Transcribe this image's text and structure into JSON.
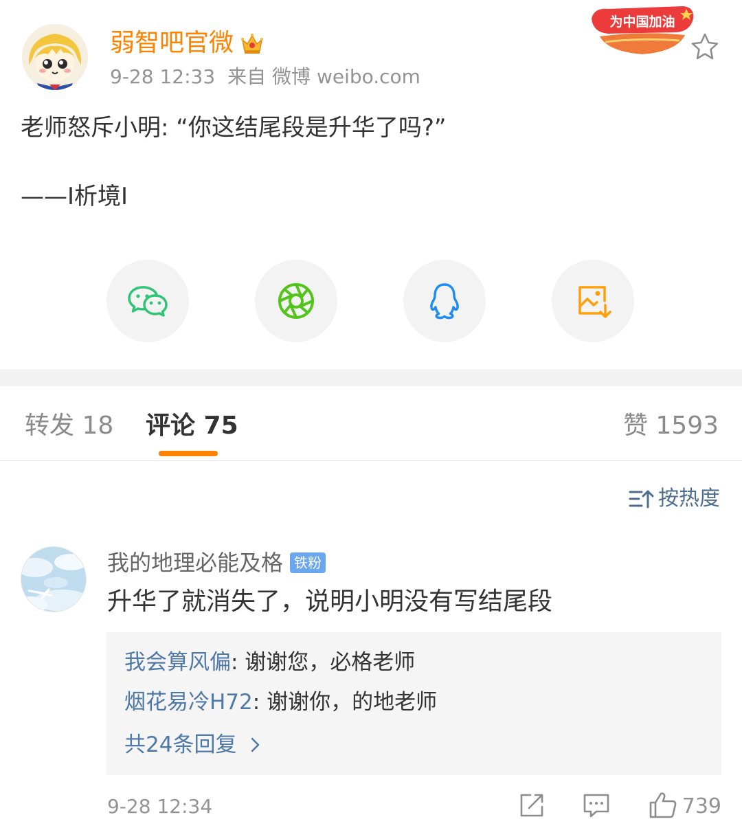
{
  "post": {
    "author": "弱智吧官微",
    "time": "9-28 12:33",
    "source": "来自 微博 weibo.com",
    "badge_text": "为中国加油",
    "text": "老师怒斥小明: “你这结尾段是升华了吗?”",
    "signature": "——I析境I"
  },
  "share": {
    "icons": [
      "wechat-icon",
      "moments-icon",
      "qq-icon",
      "save-image-icon"
    ],
    "colors": {
      "wechat": "#2fc475",
      "moments": "#52c41a",
      "qq": "#1e8cf2",
      "save": "#ff9f0a"
    }
  },
  "tabs": {
    "repost": "转发 18",
    "comment": "评论 75",
    "like": "赞 1593"
  },
  "sort": {
    "label": "按热度"
  },
  "comment": {
    "user": "我的地理必能及格",
    "fan_badge": "铁粉",
    "text": "升华了就消失了，说明小明没有写结尾段",
    "replies": [
      {
        "user": "我会算风偏",
        "text": ": 谢谢您，必格老师"
      },
      {
        "user": "烟花易冷H72",
        "text": ": 谢谢你，的地老师"
      }
    ],
    "more_replies": "共24条回复",
    "time": "9-28 12:34",
    "likes": "739"
  },
  "colors": {
    "accent": "#ff8200",
    "link": "#4f79a6",
    "muted": "#939393"
  }
}
